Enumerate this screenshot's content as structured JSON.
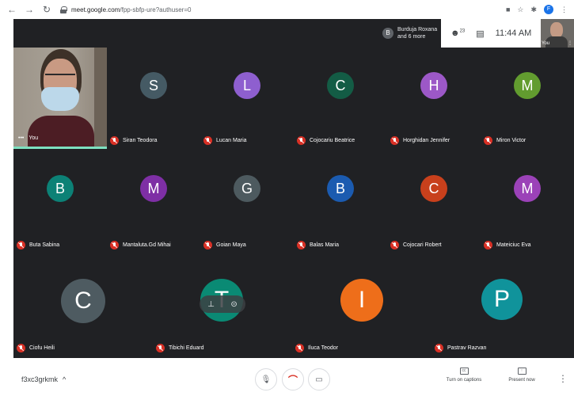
{
  "browser": {
    "url_domain": "meet.google.com",
    "url_path": "/fpp-sbfp-ure?authuser=0",
    "profile_initial": "F"
  },
  "meet_header": {
    "host_initial": "B",
    "host_name": "Burduja Roxana",
    "others": "and 6 more",
    "people_count": "23",
    "time": "11:44 AM",
    "self_label": "You"
  },
  "self_tile": {
    "label": "You",
    "menu": "•••"
  },
  "participants": [
    {
      "initial": "S",
      "name": "Siran Teodora",
      "color": "#455a64"
    },
    {
      "initial": "L",
      "name": "Lucan Maria",
      "color": "#8e5fcf"
    },
    {
      "initial": "C",
      "name": "Cojocariu Beatrice",
      "color": "#135c45"
    },
    {
      "initial": "H",
      "name": "Horghidan Jennifer",
      "color": "#9c58c7"
    },
    {
      "initial": "M",
      "name": "Miron Victor",
      "color": "#629c2f"
    },
    {
      "initial": "B",
      "name": "Buta Sabina",
      "color": "#0c8176"
    },
    {
      "initial": "M",
      "name": "Mantaluta.Gd Mihai",
      "color": "#7e2fa5"
    },
    {
      "initial": "G",
      "name": "Goian Maya",
      "color": "#4d5a5f"
    },
    {
      "initial": "B",
      "name": "Balas Maria",
      "color": "#1b5bb0"
    },
    {
      "initial": "C",
      "name": "Cojocari Robert",
      "color": "#c8401c"
    },
    {
      "initial": "M",
      "name": "Mateiciuc Eva",
      "color": "#9b42b8"
    },
    {
      "initial": "C",
      "name": "Ciofu Heili",
      "color": "#4e5b61"
    },
    {
      "initial": "T",
      "name": "Tibichi Eduard",
      "color": "#0a8a74"
    },
    {
      "initial": "I",
      "name": "Iluca Teodor",
      "color": "#ee6e1a"
    },
    {
      "initial": "P",
      "name": "Pastrav Razvan",
      "color": "#10939b"
    }
  ],
  "bottom_bar": {
    "meeting_code": "f3xc3grkmk",
    "expand_glyph": "^",
    "captions_label": "Turn on captions",
    "present_label": "Present now",
    "more_glyph": "⋮"
  }
}
